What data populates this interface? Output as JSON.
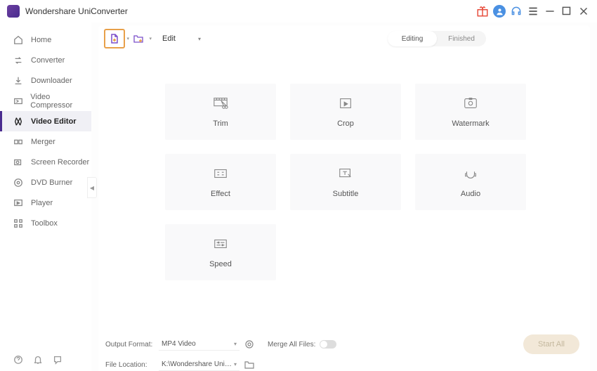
{
  "app": {
    "title": "Wondershare UniConverter"
  },
  "sidebar": {
    "items": [
      {
        "label": "Home"
      },
      {
        "label": "Converter"
      },
      {
        "label": "Downloader"
      },
      {
        "label": "Video Compressor"
      },
      {
        "label": "Video Editor"
      },
      {
        "label": "Merger"
      },
      {
        "label": "Screen Recorder"
      },
      {
        "label": "DVD Burner"
      },
      {
        "label": "Player"
      },
      {
        "label": "Toolbox"
      }
    ],
    "active_index": 4
  },
  "toolbar": {
    "edit_label": "Edit",
    "segment": {
      "editing": "Editing",
      "finished": "Finished",
      "active": "editing"
    }
  },
  "cards": [
    {
      "label": "Trim"
    },
    {
      "label": "Crop"
    },
    {
      "label": "Watermark"
    },
    {
      "label": "Effect"
    },
    {
      "label": "Subtitle"
    },
    {
      "label": "Audio"
    },
    {
      "label": "Speed"
    }
  ],
  "bottom": {
    "output_format_label": "Output Format:",
    "output_format_value": "MP4 Video",
    "file_location_label": "File Location:",
    "file_location_value": "K:\\Wondershare UniConverter",
    "merge_label": "Merge All Files:",
    "start_all_label": "Start All"
  }
}
